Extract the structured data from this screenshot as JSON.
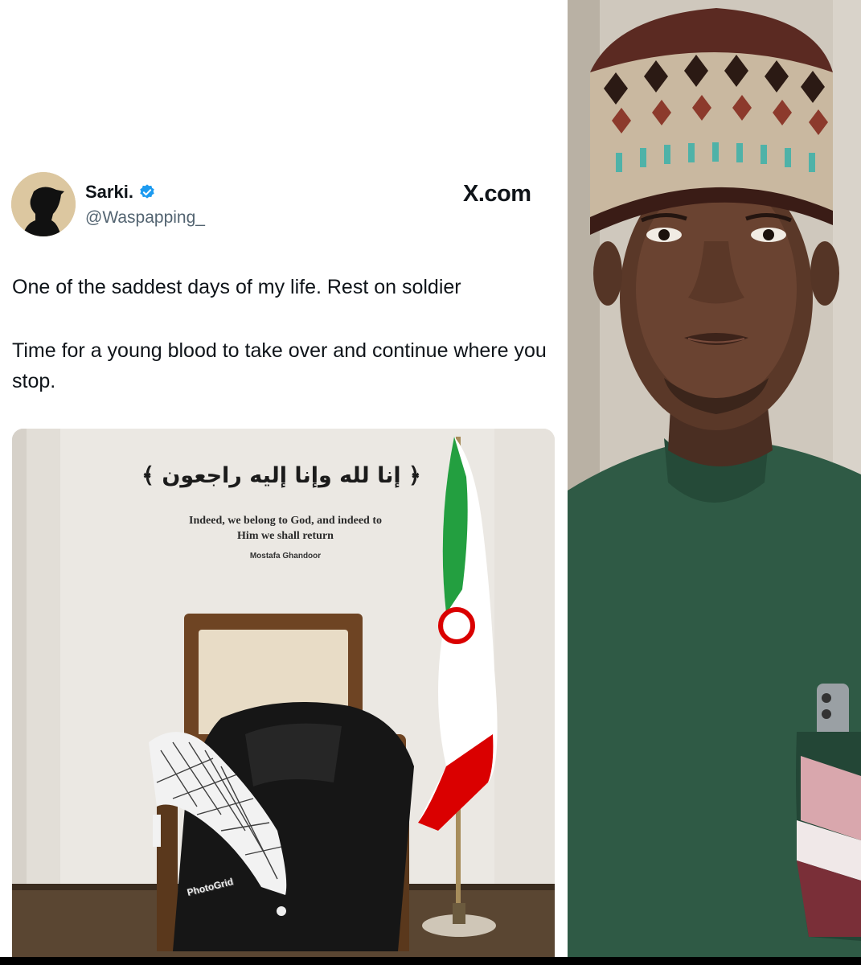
{
  "tweet": {
    "author_name": "Sarki.",
    "author_handle": "@Waspapping_",
    "verified": true,
    "brand": "X.com",
    "paragraphs": [
      "One of the saddest days of my life. Rest on soldier",
      "Time for a young blood to take over and continue where you stop."
    ]
  },
  "media": {
    "arabic_text": "﴿ إنا لله وإنا إليه راجعون ﴾",
    "translation_line1": "Indeed, we belong to God, and indeed to",
    "translation_line2": "Him we shall return",
    "author": "Mostafa Ghandoor",
    "watermark": "PhotoGrid"
  },
  "colors": {
    "verified_badge": "#1d9bf0",
    "flag_green": "#239f40",
    "flag_red": "#da0000",
    "handle_gray": "#536471"
  },
  "icons": {
    "verified": "verified-check-icon",
    "avatar": "silhouette-avatar"
  }
}
